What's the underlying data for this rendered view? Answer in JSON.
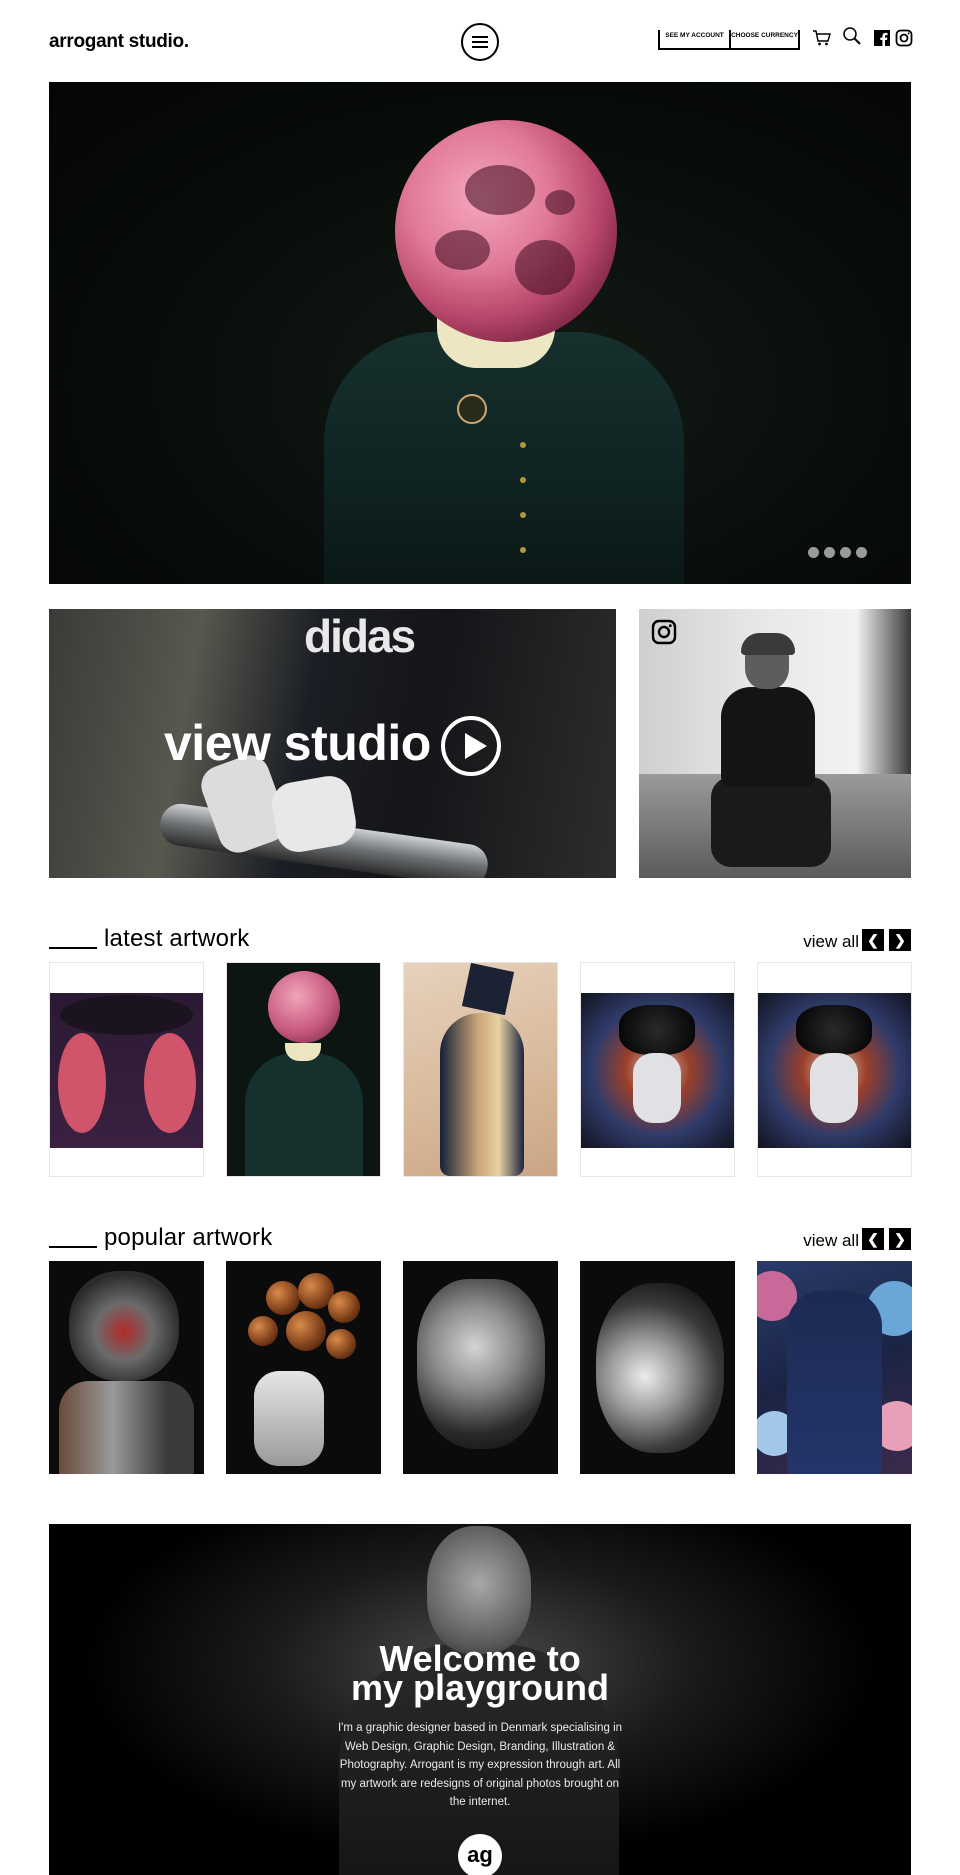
{
  "header": {
    "logo": "arrogant studio.",
    "account_link": "SEE MY ACCOUNT",
    "currency_link": "CHOOSE CURRENCY",
    "icons": [
      "menu-icon",
      "cart-icon",
      "search-icon",
      "facebook-icon",
      "instagram-icon"
    ]
  },
  "hero": {
    "slides": 4
  },
  "promo": {
    "studio_title": "view studio",
    "shirt_text": "didas"
  },
  "latest": {
    "title": "latest artwork",
    "view_all": "view all"
  },
  "popular": {
    "title": "popular artwork",
    "view_all": "view all"
  },
  "welcome": {
    "title_line1": "Welcome to",
    "title_line2": "my playground",
    "bio": "I'm a graphic designer based in Denmark specialising in Web Design, Graphic Design, Branding, Illustration & Photography. Arrogant is my expression through art. All my artwork are redesigns of original photos brought on the internet.",
    "monogram": "ag"
  }
}
